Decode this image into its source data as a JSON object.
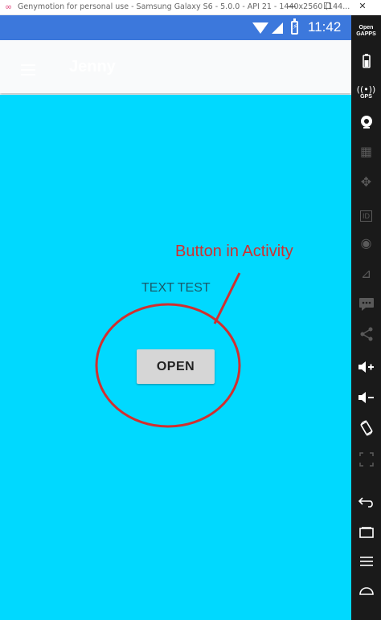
{
  "window": {
    "title": "Genymotion for personal use - Samsung Galaxy S6 - 5.0.0 - API 21 - 1440x2560 (144...",
    "minimize": "—",
    "maximize": "☐",
    "close": "✕"
  },
  "statusbar": {
    "time": "11:42",
    "battery_glyph": "⚡",
    "color": "#3c78dc"
  },
  "actionbar": {
    "title": "Jenny"
  },
  "activity": {
    "background": "#00d9ff",
    "text": "TEXT TEST",
    "button_label": "OPEN"
  },
  "annotation": {
    "label": "Button in Activity",
    "color": "#d12f2f"
  },
  "sidebar": {
    "open_gapps": [
      "Open",
      "GAPPS"
    ],
    "gps": "GPS",
    "icons": [
      "open-gapps-icon",
      "battery-icon",
      "gps-icon",
      "camera-icon",
      "video-icon",
      "remote-control-icon",
      "id-icon",
      "disk-icon",
      "rss-icon",
      "sms-icon",
      "share-icon",
      "volume-up-icon",
      "volume-down-icon",
      "rotate-icon",
      "resize-icon",
      "back-icon",
      "recent-apps-icon",
      "menu-icon",
      "home-icon"
    ]
  }
}
